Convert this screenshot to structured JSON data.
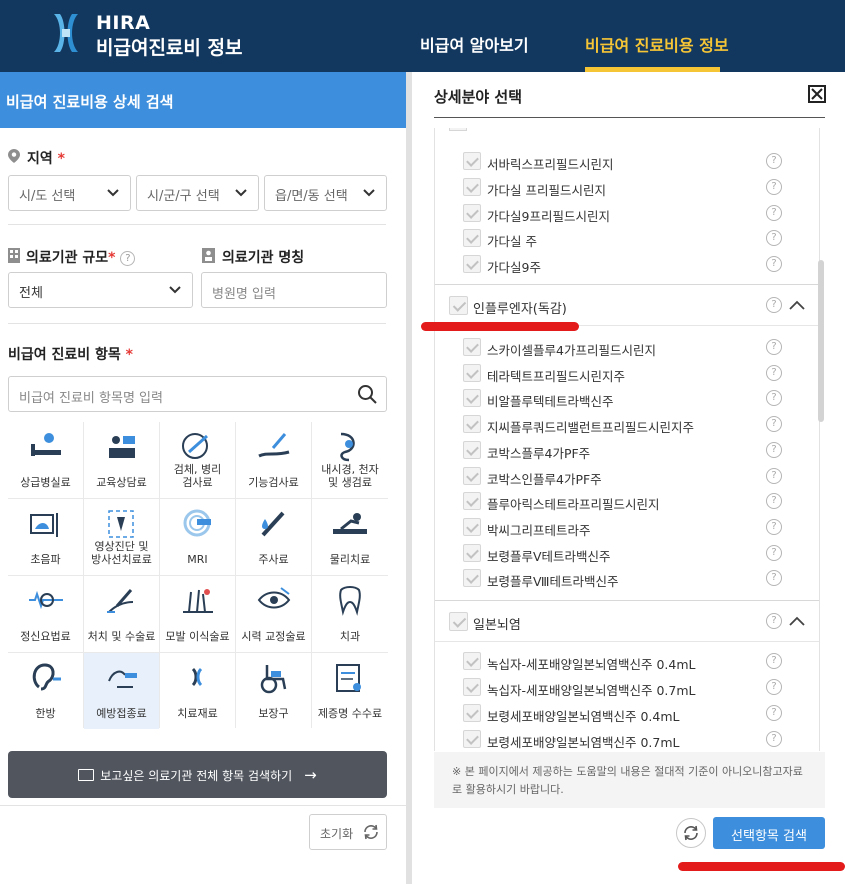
{
  "header": {
    "logo_en": "HIRA",
    "logo_ko": "비급여진료비 정보",
    "nav": [
      "비급여 알아보기",
      "비급여 진료비용 정보"
    ],
    "active_nav_color": "#f5c536"
  },
  "left": {
    "title": "비급여 진료비용 상세 검색",
    "region": {
      "label": "지역",
      "required_mark": "*",
      "selects": [
        "시/도 선택",
        "시/군/구 선택",
        "읍/면/동 선택"
      ]
    },
    "scale": {
      "label": "의료기관 규모",
      "required_mark": "*",
      "help": "?",
      "value": "전체"
    },
    "inst_name": {
      "label": "의료기관 명칭",
      "placeholder": "병원명 입력"
    },
    "items": {
      "label": "비급여 진료비 항목",
      "required_mark": "*",
      "search_placeholder": "비급여 진료비 항목명 입력",
      "categories": [
        [
          "상급병실료"
        ],
        [
          "교육상담료"
        ],
        [
          "검체, 병리",
          "검사료"
        ],
        [
          "기능검사료"
        ],
        [
          "내시경, 천자",
          "및 생검료"
        ],
        [
          "초음파"
        ],
        [
          "영상진단 및",
          "방사선치료료"
        ],
        [
          "MRI"
        ],
        [
          "주사료"
        ],
        [
          "물리치료"
        ],
        [
          "정신요법료"
        ],
        [
          "처치 및 수술료"
        ],
        [
          "모발 이식술료"
        ],
        [
          "시력 교정술료"
        ],
        [
          "치과"
        ],
        [
          "한방"
        ],
        [
          "예방접종료"
        ],
        [
          "치료재료"
        ],
        [
          "보장구"
        ],
        [
          "제증명 수수료"
        ]
      ],
      "selected_index": 16
    },
    "search_all_button": "보고싶은 의료기관 전체 항목 검색하기",
    "reset_button": "초기화"
  },
  "panel": {
    "title": "상세분야 선택",
    "group1_tail": [
      "서바릭스프리필드시린지",
      "가다실 프리필드시린지",
      "가다실9프리필드시린지",
      "가다실 주",
      "가다실9주"
    ],
    "group2": {
      "title": "인플루엔자(독감)",
      "items": [
        "스카이셀플루4가프리필드시린지",
        "테라텍트프리필드시린지주",
        "비알플루텍테트라백신주",
        "지씨플루쿼드리밸런트프리필드시린지주",
        "코박스플루4가PF주",
        "코박스인플루4가PF주",
        "플루아릭스테트라프리필드시린지",
        "박씨그리프테트라주",
        "보령플루Ⅴ테트라백신주",
        "보령플루Ⅷ테트라백신주"
      ]
    },
    "group3": {
      "title": "일본뇌염",
      "items": [
        "녹십자-세포배양일본뇌염백신주 0.4mL",
        "녹십자-세포배양일본뇌염백신주 0.7mL",
        "보령세포배양일본뇌염백신주 0.4mL",
        "보령세포배양일본뇌염백신주 0.7mL"
      ]
    },
    "help": "?",
    "notice": "※ 본 페이지에서 제공하는 도움말의 내용은 절대적 기준이 아니오니참고자료로 활용하시기 바랍니다.",
    "search_button": "선택항목 검색"
  },
  "colors": {
    "header": "#12385f",
    "accent": "#3d8fdd",
    "annotation": "#e31b1b"
  }
}
